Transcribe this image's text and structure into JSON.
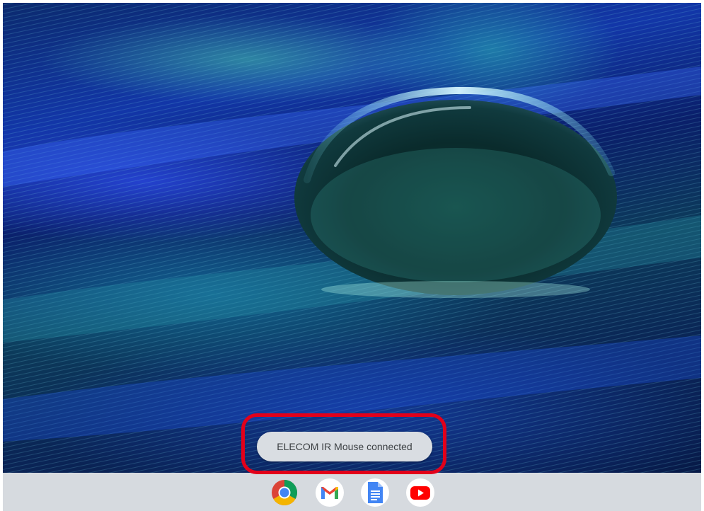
{
  "notification": {
    "message": "ELECOM IR Mouse connected",
    "highlight_color": "#e2001a"
  },
  "shelf": {
    "apps": [
      {
        "name": "Chrome",
        "icon": "chrome-icon"
      },
      {
        "name": "Gmail",
        "icon": "gmail-icon"
      },
      {
        "name": "Docs",
        "icon": "docs-icon"
      },
      {
        "name": "YouTube",
        "icon": "youtube-icon"
      }
    ],
    "gmail_letter": "M"
  },
  "wallpaper": {
    "subject": "water droplet on peacock feather",
    "colors": [
      "#1236a8",
      "#0c3b5a",
      "#3fc4b2"
    ]
  }
}
